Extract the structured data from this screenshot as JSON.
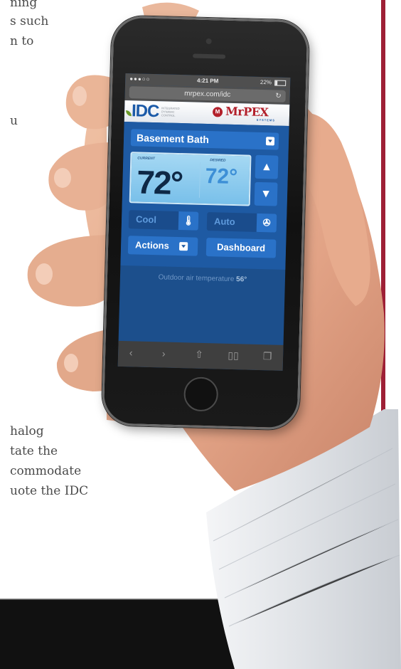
{
  "background_text": {
    "lines_top": [
      "ning",
      "s such",
      "n to"
    ],
    "line_u": "u",
    "lines_bottom": [
      "halog",
      "tate the",
      "commodate",
      "uote the IDC"
    ]
  },
  "phone": {
    "status": {
      "signal": "●●●○○",
      "time": "4:21 PM",
      "battery": "22%"
    },
    "url": "mrpex.com/idc",
    "logos": {
      "idc": "IDC",
      "idc_tagline": "INTEGRATED DYNAMIC CONTROL",
      "mrpex": "MrPEX",
      "mrpex_sub": "SYSTEMS"
    },
    "zone": "Basement Bath",
    "temperature": {
      "current_label": "CURRENT",
      "desired_label": "DESIRED",
      "current": "72°",
      "desired": "72°"
    },
    "arrows": {
      "up": "▲",
      "down": "▼"
    },
    "modes": {
      "cool": "Cool",
      "auto": "Auto"
    },
    "buttons": {
      "actions": "Actions",
      "dashboard": "Dashboard"
    },
    "outdoor": {
      "label": "Outdoor air temperature",
      "value": "56°"
    },
    "toolbar": {
      "back": "‹",
      "forward": "›",
      "share": "⇧",
      "bookmarks": "▯▯",
      "tabs": "❐"
    }
  },
  "colors": {
    "accent_red": "#9e2036",
    "screen_blue": "#1e5aa3",
    "button_blue": "#2a72c8",
    "display_blue": "#a5d8f3"
  }
}
